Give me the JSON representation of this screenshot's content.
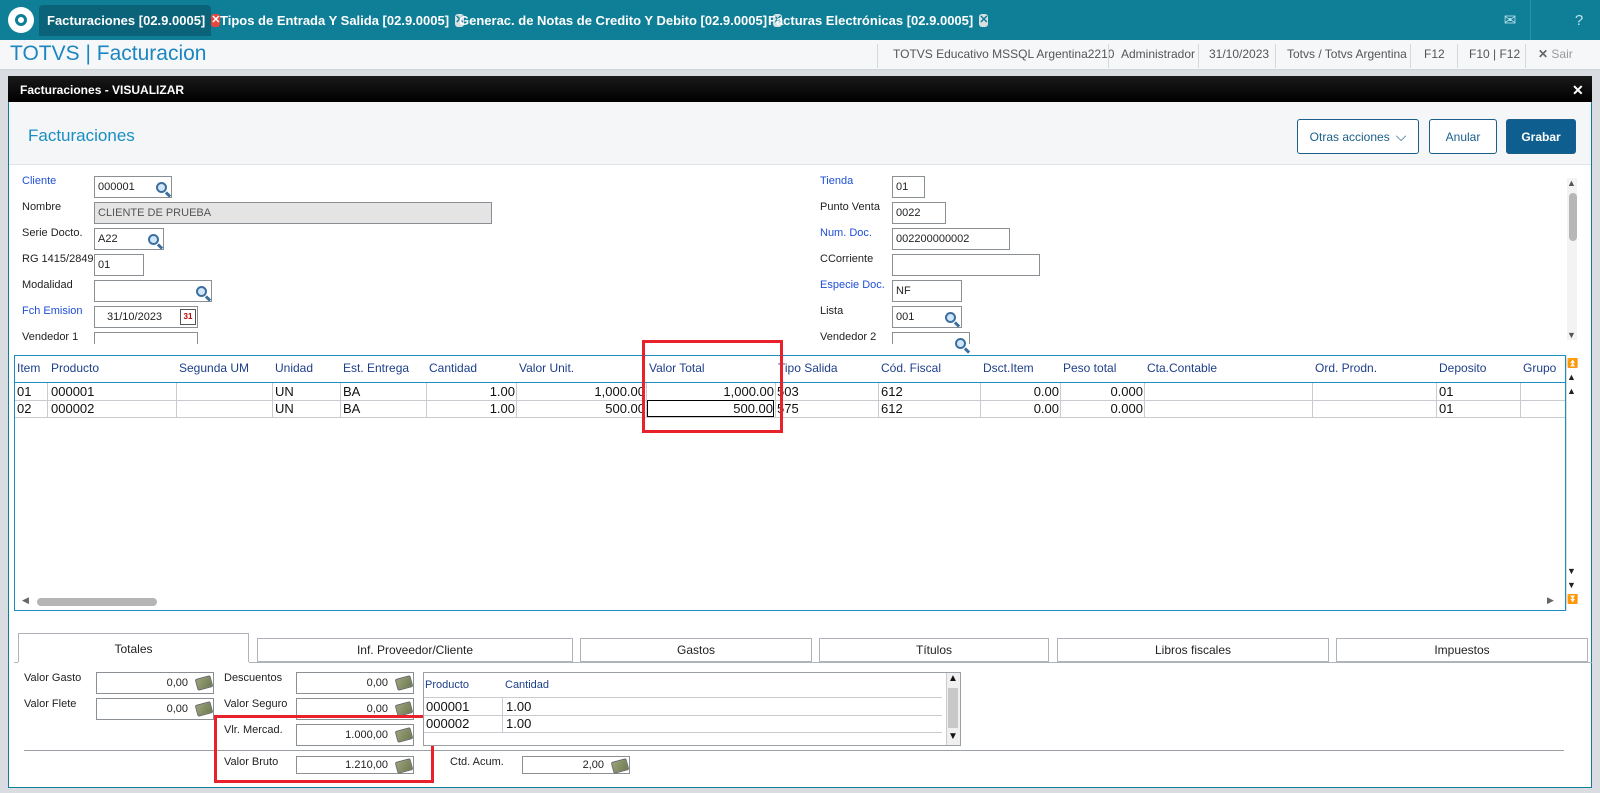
{
  "tabs": [
    {
      "label": "Facturaciones [02.9.0005]"
    },
    {
      "label": "Tipos de Entrada Y Salida [02.9.0005]"
    },
    {
      "label": "Generac. de Notas de Credito Y Debito [02.9.0005]"
    },
    {
      "label": "Facturas Electrónicas [02.9.0005]"
    }
  ],
  "header": {
    "app_title": "TOTVS | Facturacion",
    "environment": "TOTVS Educativo MSSQL Argentina2210",
    "user": "Administrador",
    "date": "31/10/2023",
    "company": "Totvs / Totvs Argentina",
    "f12": "F12",
    "f10": "F10 | F12",
    "exit": "Sair"
  },
  "dialog": {
    "title": "Facturaciones - VISUALIZAR",
    "section_title": "Facturaciones",
    "buttons": {
      "other_actions": "Otras acciones",
      "cancel": "Anular",
      "save": "Grabar"
    }
  },
  "form": {
    "cliente": {
      "label": "Cliente",
      "value": "000001"
    },
    "nombre": {
      "label": "Nombre",
      "value": "CLIENTE DE PRUEBA"
    },
    "serie": {
      "label": "Serie Docto.",
      "value": "A22"
    },
    "rg": {
      "label": "RG 1415/2849",
      "value": "01"
    },
    "modalidad": {
      "label": "Modalidad",
      "value": ""
    },
    "fch_emision": {
      "label": "Fch Emision",
      "value": "31/10/2023"
    },
    "vendedor1": {
      "label": "Vendedor 1",
      "value": ""
    },
    "tienda": {
      "label": "Tienda",
      "value": "01"
    },
    "punto_venta": {
      "label": "Punto Venta",
      "value": "0022"
    },
    "num_doc": {
      "label": "Num. Doc.",
      "value": "002200000002"
    },
    "ccorriente": {
      "label": "CCorriente",
      "value": ""
    },
    "especie": {
      "label": "Especie Doc.",
      "value": "NF"
    },
    "lista": {
      "label": "Lista",
      "value": "001"
    },
    "vendedor2": {
      "label": "Vendedor 2",
      "value": ""
    }
  },
  "grid": {
    "columns": [
      "Item",
      "Producto",
      "Segunda UM",
      "Unidad",
      "Est. Entrega",
      "Cantidad",
      "Valor Unit.",
      "Valor Total",
      "Tipo Salida",
      "Cód. Fiscal",
      "Dsct.Item",
      "Peso total",
      "Cta.Contable",
      "Ord. Prodn.",
      "Deposito",
      "Grupo"
    ],
    "rows": [
      {
        "item": "01",
        "producto": "000001",
        "segunda_um": "",
        "unidad": "UN",
        "est_entrega": "BA",
        "cantidad": "1.00",
        "valor_unit": "1,000.00",
        "valor_total": "1,000.00",
        "tipo_salida": "503",
        "cod_fiscal": "612",
        "dsct_item": "0.00",
        "peso_total": "0.000",
        "cta_contable": "",
        "ord_prodn": "",
        "deposito": "01",
        "grupo": ""
      },
      {
        "item": "02",
        "producto": "000002",
        "segunda_um": "",
        "unidad": "UN",
        "est_entrega": "BA",
        "cantidad": "1.00",
        "valor_unit": "500.00",
        "valor_total": "500.00",
        "tipo_salida": "575",
        "cod_fiscal": "612",
        "dsct_item": "0.00",
        "peso_total": "0.000",
        "cta_contable": "",
        "ord_prodn": "",
        "deposito": "01",
        "grupo": ""
      }
    ]
  },
  "bottom_tabs": [
    "Totales",
    "Inf. Proveedor/Cliente",
    "Gastos",
    "Títulos",
    "Libros fiscales",
    "Impuestos"
  ],
  "totals": {
    "valor_gasto": {
      "label": "Valor Gasto",
      "value": "0,00"
    },
    "valor_flete": {
      "label": "Valor Flete",
      "value": "0,00"
    },
    "descuentos": {
      "label": "Descuentos",
      "value": "0,00"
    },
    "valor_seguro": {
      "label": "Valor Seguro",
      "value": "0,00"
    },
    "vlr_mercad": {
      "label": "Vlr. Mercad.",
      "value": "1.000,00"
    },
    "valor_bruto": {
      "label": "Valor Bruto",
      "value": "1.210,00"
    },
    "ctd_acum": {
      "label": "Ctd. Acum.",
      "value": "2,00"
    },
    "mini_grid": {
      "columns": [
        "Producto",
        "Cantidad"
      ],
      "rows": [
        [
          "000001",
          "1.00"
        ],
        [
          "000002",
          "1.00"
        ]
      ]
    }
  },
  "colors": {
    "tabbar": "#0e7f97",
    "accent": "#1a8ec2",
    "highlight": "#e8212a",
    "primary_button": "#0e5f8f"
  }
}
